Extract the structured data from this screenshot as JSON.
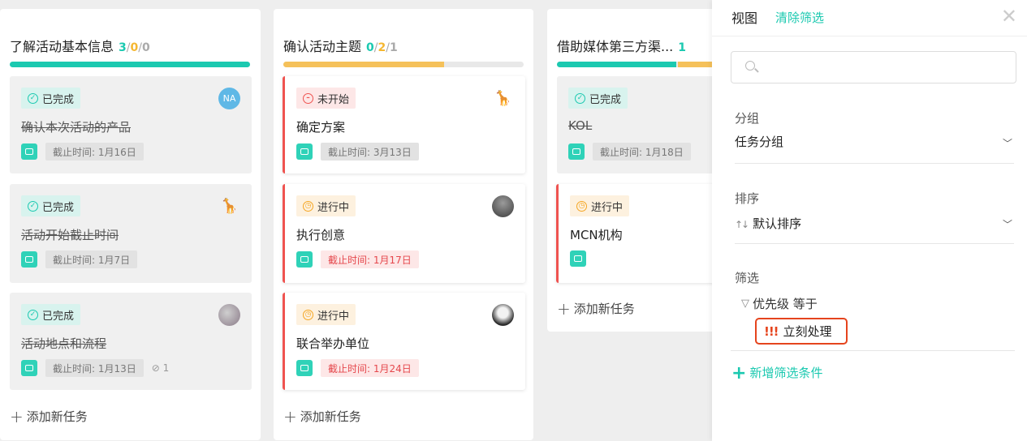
{
  "columns": [
    {
      "title": "了解活动基本信息",
      "count_done": "3",
      "count_progress": "0",
      "count_todo": "0",
      "progress": {
        "done": 1.0,
        "in_progress": 0.0
      },
      "cards": [
        {
          "status": "已完成",
          "title": "确认本次活动的产品",
          "due": "截止时间: 1月16日",
          "avatar": "NA"
        },
        {
          "status": "已完成",
          "title": "活动开始截止时间",
          "due": "截止时间: 1月7日",
          "avatar": "giraffe"
        },
        {
          "status": "已完成",
          "title": "活动地点和流程",
          "due": "截止时间: 1月13日",
          "attachments": "1",
          "avatar": "photo"
        }
      ],
      "add_task": "添加新任务"
    },
    {
      "title": "确认活动主题",
      "count_done": "0",
      "count_progress": "2",
      "count_todo": "1",
      "progress": {
        "done": 0.0,
        "in_progress": 0.67
      },
      "cards": [
        {
          "status": "未开始",
          "title": "确定方案",
          "due": "截止时间: 3月13日",
          "avatar": "giraffe"
        },
        {
          "status": "进行中",
          "title": "执行创意",
          "due": "截止时间: 1月17日",
          "avatar": "photo"
        },
        {
          "status": "进行中",
          "title": "联合举办单位",
          "due": "截止时间: 1月24日",
          "avatar": "photo"
        }
      ],
      "add_task": "添加新任务"
    },
    {
      "title": "借助媒体第三方渠...",
      "count_done": "1",
      "progress": {
        "done": 0.5,
        "in_progress": 0.5
      },
      "cards": [
        {
          "status": "已完成",
          "title": "KOL",
          "due": "截止时间: 1月18日"
        },
        {
          "status": "进行中",
          "title": "MCN机构"
        }
      ],
      "add_task": "添加新任务"
    }
  ],
  "panel": {
    "title": "视图",
    "clear_filter": "清除筛选",
    "search_placeholder": "",
    "group_label": "分组",
    "group_value": "任务分组",
    "sort_label": "排序",
    "sort_value": "默认排序",
    "filter_label": "筛选",
    "filter_condition": "优先级 等于",
    "priority_marks": "!!!",
    "priority_value": "立刻处理",
    "add_filter": "新增筛选条件"
  },
  "colors": {
    "teal": "#1bc9b0",
    "yellow": "#f5b731",
    "red": "#ef5350",
    "highlight": "#e5441d"
  }
}
